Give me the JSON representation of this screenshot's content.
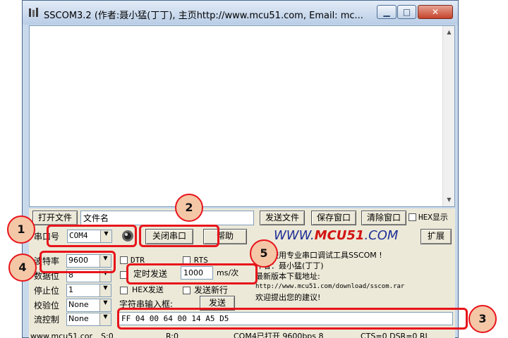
{
  "window": {
    "title": "SSCOM3.2 (作者:聂小猛(丁丁), 主页http://www.mcu51.com,  Email: mc..."
  },
  "toolbar": {
    "open_file_label": "打开文件",
    "filename_value": "文件名",
    "send_file_label": "发送文件",
    "save_window_label": "保存窗口",
    "clear_window_label": "清除窗口",
    "hex_display_label": "HEX显示"
  },
  "port": {
    "label": "串口号",
    "value": "COM4",
    "close_port_label": "关闭串口",
    "help_label": "帮助",
    "expand_label": "扩展"
  },
  "serial_settings": {
    "baud_label": "波特率",
    "baud_value": "9600",
    "data_bits_label": "数据位",
    "data_bits_value": "8",
    "stop_bits_label": "停止位",
    "stop_bits_value": "1",
    "parity_label": "校验位",
    "parity_value": "None",
    "flow_label": "流控制",
    "flow_value": "None"
  },
  "signals": {
    "dtr_label": "DTR",
    "rts_label": "RTS"
  },
  "send": {
    "timed_send_label": "定时发送",
    "interval_value": "1000",
    "interval_unit": "ms/次",
    "hex_send_label": "HEX发送",
    "send_newline_label": "发送新行",
    "input_label": "字符串输入框:",
    "send_label": "发送",
    "input_value": "FF 04 00 64 00 14 A5 D5"
  },
  "logo": {
    "prefix": "WWW.",
    "brand": "MCU51",
    "suffix": ".COM"
  },
  "info": {
    "lines": [
      "欢迎使用专业串口调试工具SSCOM !",
      "作者：聂小猛(丁丁)",
      "最新版本下载地址:",
      "http://www.mcu51.com/download/sscom.rar",
      "欢迎提出您的建议!"
    ]
  },
  "statusbar": {
    "site": "www.mcu51.cor",
    "sent": "S:0",
    "received": "R:0",
    "port_status": "COM4已打开  9600bps  8",
    "lines": "CTS=0 DSR=0 RL"
  },
  "annotations": [
    "1",
    "2",
    "3",
    "4",
    "5"
  ],
  "colors": {
    "annotation_red": "#e8141b",
    "badge_fill": "#f4c7a7",
    "logo_blue": "#1e2f96",
    "logo_red": "#d21414"
  }
}
